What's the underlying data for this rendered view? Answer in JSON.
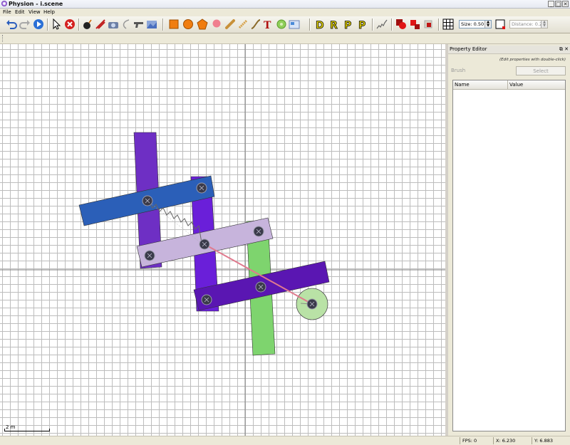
{
  "window": {
    "title": "Physion - i.scene",
    "min": "_",
    "max": "□",
    "close": "✕"
  },
  "menu": [
    "File",
    "Edit",
    "View",
    "Help"
  ],
  "toolbar": {
    "letter_tools": [
      "D",
      "R",
      "P",
      "P"
    ],
    "size": {
      "label": "Size:",
      "value": "0.50"
    },
    "distance": {
      "label": "Distance:",
      "value": "0.20"
    }
  },
  "scale": {
    "label": "2 m"
  },
  "property_editor": {
    "title": "Property Editor",
    "hint": "(Edit properties with double-click)",
    "brush_label": "Brush",
    "select_button": "Select",
    "columns": [
      "Name",
      "Value"
    ]
  },
  "status": {
    "fps": "FPS: 0",
    "x": "X: 6.230",
    "y": "Y: 6.883"
  },
  "colors": {
    "bar_violet": "#6e2fc4",
    "bar_purple": "#6a1fd9",
    "bar_blue": "#2b5fb8",
    "bar_lilac": "#c7b4dc",
    "bar_indigo": "#5a16b2",
    "bar_green": "#7ed46e",
    "wheel": "#b9e2a6",
    "rope": "#e07a8e",
    "axes": "#808080"
  }
}
